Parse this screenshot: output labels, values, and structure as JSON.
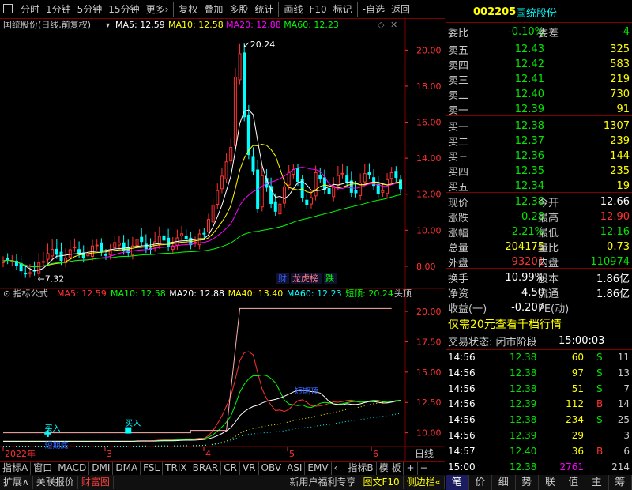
{
  "toolbar": {
    "items": [
      "分时",
      "1分钟",
      "5分钟",
      "15分钟",
      "更多›",
      "复权",
      "叠加",
      "多股",
      "统计",
      "画线",
      "F10",
      "标记",
      "-自选",
      "返回"
    ]
  },
  "main_chart": {
    "title": "国统股份(日线,前复权)",
    "ma": [
      {
        "label": "MA5: 12.59",
        "color": "#ffffff"
      },
      {
        "label": "MA10: 12.58",
        "color": "#ffff00"
      },
      {
        "label": "MA20: 12.88",
        "color": "#ff00ff"
      },
      {
        "label": "MA60: 12.23",
        "color": "#00ff00"
      }
    ],
    "high_label": "20.24",
    "low_label": "7.32",
    "badges": [
      {
        "t": "财",
        "c": "#3264ff"
      },
      {
        "t": "龙虎榜",
        "c": "#ff8080"
      },
      {
        "t": "跌",
        "c": "#00ff00"
      }
    ],
    "y_ticks": [
      "20.00",
      "18.00",
      "16.00",
      "14.00",
      "12.00",
      "10.00",
      "8.00"
    ],
    "y_values": [
      20,
      18,
      16,
      14,
      12,
      10,
      8
    ],
    "ylim": [
      6.9,
      21.2
    ]
  },
  "ind_chart": {
    "title": "指标公式",
    "ma": [
      {
        "label": "MA5: 12.59",
        "color": "#ff3232"
      },
      {
        "label": "MA10: 12.58",
        "color": "#00ff00"
      },
      {
        "label": "MA20: 12.88",
        "color": "#ffffff"
      },
      {
        "label": "MA40: 13.40",
        "color": "#ffff00"
      },
      {
        "label": "MA60: 12.23",
        "color": "#00ffff"
      },
      {
        "label": "短顶: 20.24",
        "color": "#00ff00"
      },
      {
        "label": "头顶",
        "color": "#c8c8c8"
      }
    ],
    "y_ticks": [
      "20.00",
      "17.50",
      "15.00",
      "12.50",
      "10.00"
    ],
    "y_values": [
      20,
      17.5,
      15,
      12.5,
      10
    ],
    "ylim": [
      9,
      21.5
    ],
    "annotations": [
      "买入",
      "买入",
      "短期底",
      "短期顶"
    ]
  },
  "x_axis": {
    "labels": [
      "2022年",
      "3",
      "4",
      "5",
      "6"
    ],
    "right_label": "日线"
  },
  "bottom_tabs": [
    "指标A",
    "窗口",
    "MACD",
    "DMI",
    "DMA",
    "FSL",
    "TRIX",
    "BRAR",
    "CR",
    "VR",
    "OBV",
    "ASI",
    "EMV",
    "‹",
    "指标B",
    "模 板",
    "+",
    "−"
  ],
  "status_bar": [
    "扩展∧",
    "关联报价",
    "财富图",
    "新用户福利专享",
    "图文F10",
    "侧边栏«"
  ],
  "quote": {
    "code": "002205",
    "name": "国统股份",
    "weibi_label": "委比",
    "weibi": "-0.10%",
    "weicha_label": "委差",
    "weicha": "-4",
    "asks": [
      {
        "l": "卖五",
        "p": "12.43",
        "v": "325"
      },
      {
        "l": "卖四",
        "p": "12.42",
        "v": "583"
      },
      {
        "l": "卖三",
        "p": "12.41",
        "v": "219"
      },
      {
        "l": "卖二",
        "p": "12.40",
        "v": "730"
      },
      {
        "l": "卖一",
        "p": "12.39",
        "v": "91"
      }
    ],
    "bids": [
      {
        "l": "买一",
        "p": "12.38",
        "v": "1307"
      },
      {
        "l": "买二",
        "p": "12.37",
        "v": "239"
      },
      {
        "l": "买三",
        "p": "12.36",
        "v": "144"
      },
      {
        "l": "买四",
        "p": "12.35",
        "v": "235"
      },
      {
        "l": "买五",
        "p": "12.34",
        "v": "19"
      }
    ],
    "stats": [
      {
        "l1": "现价",
        "v1": "12.38",
        "c1": "grn",
        "l2": "今开",
        "v2": "12.66",
        "c2": "wht"
      },
      {
        "l1": "涨跌",
        "v1": "-0.28",
        "c1": "grn",
        "l2": "最高",
        "v2": "12.90",
        "c2": "red"
      },
      {
        "l1": "涨幅",
        "v1": "-2.21%",
        "c1": "grn",
        "l2": "最低",
        "v2": "12.16",
        "c2": "grn"
      },
      {
        "l1": "总量",
        "v1": "204175",
        "c1": "yel",
        "l2": "量比",
        "v2": "0.73",
        "c2": "yel"
      },
      {
        "l1": "外盘",
        "v1": "93201",
        "c1": "red",
        "l2": "内盘",
        "v2": "110974",
        "c2": "grn"
      }
    ],
    "stats2": [
      {
        "l1": "换手",
        "v1": "10.99%",
        "l2": "股本",
        "v2": "1.86亿"
      },
      {
        "l1": "净资",
        "v1": "4.50",
        "l2": "流通",
        "v2": "1.86亿"
      },
      {
        "l1": "收益(一)",
        "v1": "-0.207",
        "l2": "PE(动)",
        "v2": ""
      }
    ],
    "promo": "仅需20元查看千档行情",
    "state_label": "交易状态: 闭市阶段",
    "state_time": "15:00:03",
    "ticks": [
      {
        "t": "14:56",
        "p": "12.38",
        "v": "60",
        "s": "S",
        "n": "11"
      },
      {
        "t": "14:56",
        "p": "12.38",
        "v": "97",
        "s": "S",
        "n": "13"
      },
      {
        "t": "14:56",
        "p": "12.38",
        "v": "51",
        "s": "S",
        "n": "7"
      },
      {
        "t": "14:56",
        "p": "12.39",
        "v": "112",
        "s": "B",
        "n": "14"
      },
      {
        "t": "14:56",
        "p": "12.38",
        "v": "234",
        "s": "S",
        "n": "25"
      },
      {
        "t": "14:56",
        "p": "12.39",
        "v": "29",
        "s": "",
        "n": "3"
      },
      {
        "t": "14:57",
        "p": "12.40",
        "v": "36",
        "s": "B",
        "n": "6"
      },
      {
        "t": "15:00",
        "p": "12.38",
        "v": "2761",
        "s": "",
        "n": "214"
      }
    ],
    "trade_buttons": [
      "笔",
      "价",
      "细",
      "势",
      "联",
      "值",
      "主",
      "筹"
    ]
  }
}
